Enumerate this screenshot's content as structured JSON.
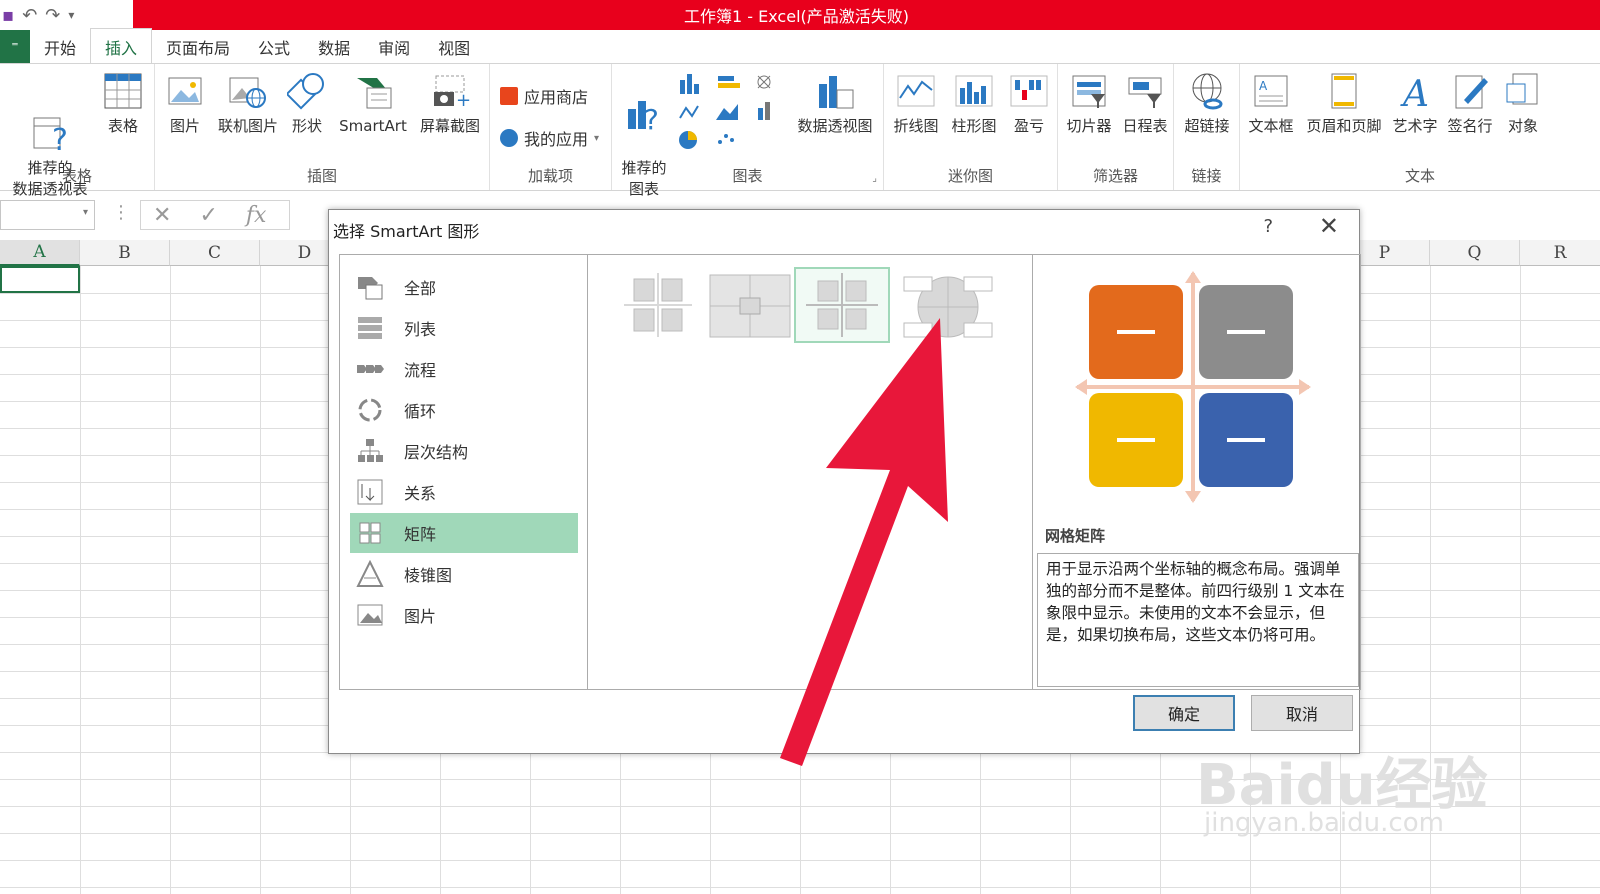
{
  "window": {
    "title": "工作簿1 -  Excel(产品激活失败)"
  },
  "qat": {
    "save_icon": "save-icon",
    "undo_icon": "undo-icon",
    "redo_icon": "redo-icon"
  },
  "tabs": [
    {
      "label": "文件"
    },
    {
      "label": "开始"
    },
    {
      "label": "插入"
    },
    {
      "label": "页面布局"
    },
    {
      "label": "公式"
    },
    {
      "label": "数据"
    },
    {
      "label": "审阅"
    },
    {
      "label": "视图"
    }
  ],
  "ribbon": {
    "groups": {
      "tables": "表格",
      "illustrations": "插图",
      "addins": "加载项",
      "charts": "图表",
      "sparklines": "迷你图",
      "filters": "筛选器",
      "links": "链接",
      "text": "文本"
    },
    "buttons": {
      "recommended_pivot": "推荐的\n数据透视表",
      "table": "表格",
      "picture": "图片",
      "online_picture": "联机图片",
      "shapes": "形状",
      "smartart": "SmartArt",
      "screenshot": "屏幕截图",
      "store": "应用商店",
      "my_apps": "我的应用",
      "recommended_charts": "推荐的\n图表",
      "pivot_chart": "数据透视图",
      "line": "折线图",
      "column": "柱形图",
      "win_loss": "盈亏",
      "slicer": "切片器",
      "timeline": "日程表",
      "hyperlink": "超链接",
      "textbox": "文本框",
      "header_footer": "页眉和页脚",
      "wordart": "艺术字",
      "signature": "签名行",
      "object": "对象"
    }
  },
  "formula_bar": {
    "cancel": "✕",
    "enter": "✓",
    "fx": "fx"
  },
  "sheet": {
    "columns": [
      "A",
      "B",
      "C",
      "D",
      "P",
      "Q",
      "R"
    ]
  },
  "dialog": {
    "title": "选择 SmartArt 图形",
    "help": "?",
    "close": "✕",
    "categories": [
      {
        "label": "全部"
      },
      {
        "label": "列表"
      },
      {
        "label": "流程"
      },
      {
        "label": "循环"
      },
      {
        "label": "层次结构"
      },
      {
        "label": "关系"
      },
      {
        "label": "矩阵"
      },
      {
        "label": "棱锥图"
      },
      {
        "label": "图片"
      }
    ],
    "selected_category": "矩阵",
    "preview": {
      "name": "网格矩阵",
      "description": "用于显示沿两个坐标轴的概念布局。强调单独的部分而不是整体。前四行级别 1 文本在象限中显示。未使用的文本不会显示，但是，如果切换布局，这些文本仍将可用。",
      "colors": [
        "#e36a1c",
        "#8c8c8c",
        "#f0b800",
        "#3a62ad"
      ]
    },
    "ok": "确定",
    "cancel": "取消"
  },
  "watermark": {
    "logo": "Baidu经验",
    "url": "jingyan.baidu.com"
  }
}
